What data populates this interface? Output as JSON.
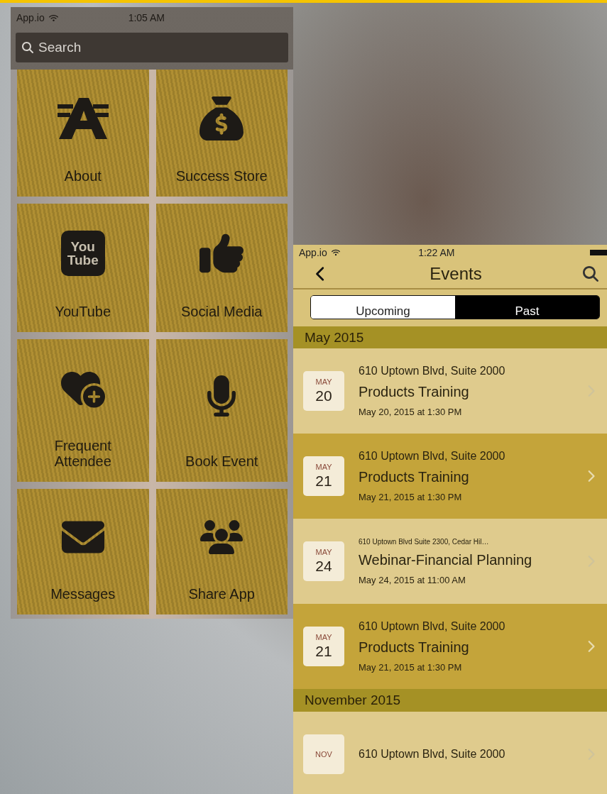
{
  "home": {
    "status_bar": {
      "carrier": "App.io",
      "time": "1:05 AM"
    },
    "search": {
      "placeholder": "Search"
    },
    "tiles": [
      {
        "label": "About",
        "kind": "about"
      },
      {
        "label": "Success Store",
        "kind": "store"
      },
      {
        "label": "YouTube",
        "kind": "video",
        "icon_text": "You Tube"
      },
      {
        "label": "Social Media",
        "kind": "like"
      },
      {
        "label": "Frequent\nAttendee",
        "kind": "heart"
      },
      {
        "label": "Book Event",
        "kind": "mic"
      },
      {
        "label": "Messages",
        "kind": "mail"
      },
      {
        "label": "Share App",
        "kind": "group"
      }
    ]
  },
  "events": {
    "status_bar": {
      "carrier": "App.io",
      "time": "1:22 AM"
    },
    "title": "Events",
    "tabs": [
      {
        "label": "Upcoming",
        "selected": false
      },
      {
        "label": "Past",
        "selected": true
      }
    ],
    "sections": [
      {
        "title": "May 2015",
        "events": [
          {
            "month": "MAY",
            "day": "20",
            "address": "610 Uptown Blvd, Suite 2000",
            "name": "Products Training",
            "when": "May 20, 2015 at 1:30 PM",
            "highlighted": false,
            "compact": false
          },
          {
            "month": "MAY",
            "day": "21",
            "address": "610 Uptown Blvd, Suite 2000",
            "name": "Products Training",
            "when": "May 21, 2015 at 1:30 PM",
            "highlighted": true,
            "compact": false
          },
          {
            "month": "MAY",
            "day": "24",
            "address": "610 Uptown Blvd Suite 2300, Cedar Hil…",
            "name": "Webinar-Financial Planning",
            "when": "May 24, 2015 at 11:00 AM",
            "highlighted": false,
            "compact": true
          },
          {
            "month": "MAY",
            "day": "21",
            "address": "610 Uptown Blvd, Suite 2000",
            "name": "Products Training",
            "when": "May 21, 2015 at 1:30 PM",
            "highlighted": true,
            "compact": false
          }
        ]
      },
      {
        "title": "November 2015",
        "events": [
          {
            "month": "NOV",
            "address": "610 Uptown Blvd, Suite 2000",
            "highlighted": false,
            "compact": false
          }
        ]
      }
    ]
  }
}
